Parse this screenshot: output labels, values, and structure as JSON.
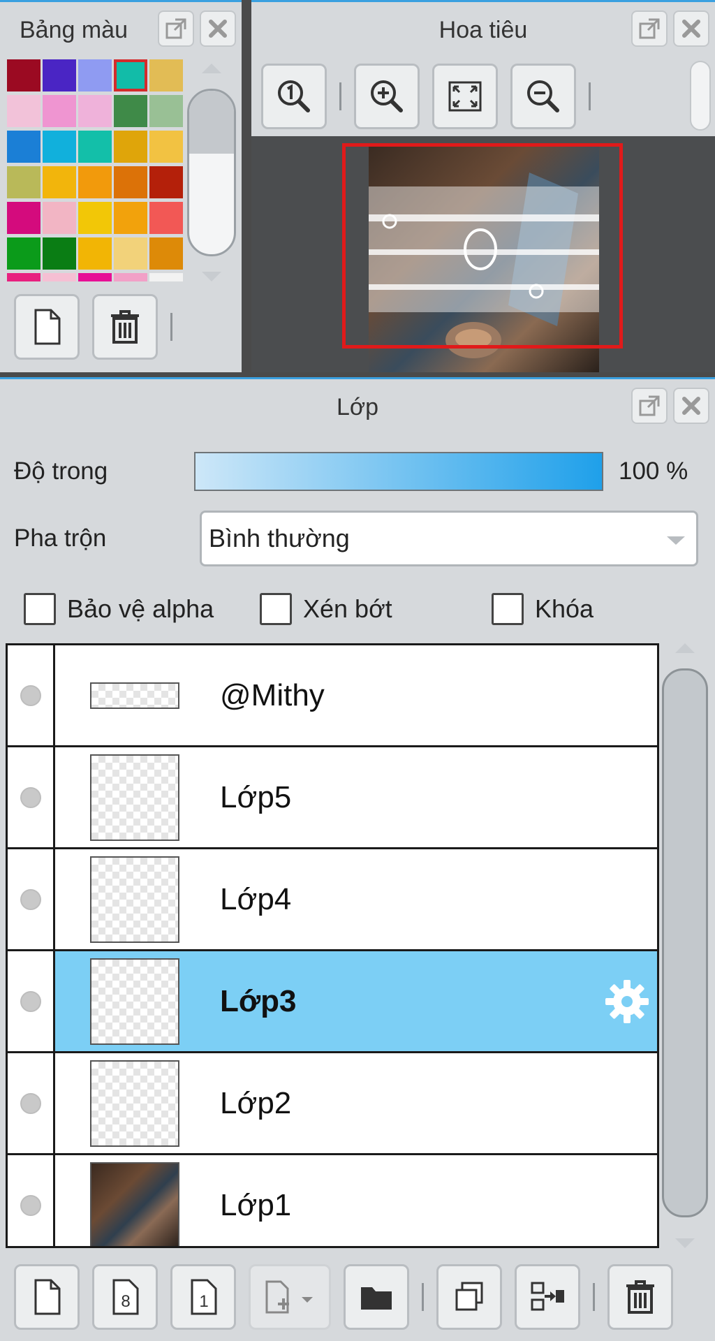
{
  "palette": {
    "title": "Bảng màu",
    "swatches": [
      {
        "color": "#9b0a22"
      },
      {
        "color": "#4a25c4"
      },
      {
        "color": "#8f9bf2"
      },
      {
        "color": "#12bca8",
        "selected": true
      },
      {
        "color": "#e2bc55"
      },
      {
        "color": "#f2c2d9"
      },
      {
        "color": "#ef95d1"
      },
      {
        "color": "#efb2da"
      },
      {
        "color": "#3f8a48"
      },
      {
        "color": "#99c095"
      },
      {
        "color": "#1b7fd6"
      },
      {
        "color": "#11b0dc"
      },
      {
        "color": "#13bfa9"
      },
      {
        "color": "#dfa50a"
      },
      {
        "color": "#f2c242"
      },
      {
        "color": "#b9b959"
      },
      {
        "color": "#f2b50c"
      },
      {
        "color": "#f29a0c"
      },
      {
        "color": "#dc7208"
      },
      {
        "color": "#b4200a"
      },
      {
        "color": "#d40b7d"
      },
      {
        "color": "#f2b5c4"
      },
      {
        "color": "#f2c707"
      },
      {
        "color": "#f2a20c"
      },
      {
        "color": "#f25855"
      },
      {
        "color": "#0b9b1a"
      },
      {
        "color": "#0a7d14"
      },
      {
        "color": "#f2b505"
      },
      {
        "color": "#f2d27a"
      },
      {
        "color": "#dd8a08"
      },
      {
        "color": "#e8207f"
      },
      {
        "color": "#f5bfd3"
      },
      {
        "color": "#e70f95"
      },
      {
        "color": "#f2a0c7"
      },
      {
        "color": "#f2f2f2"
      }
    ],
    "buttons": [
      "new-swatch",
      "delete-swatch"
    ]
  },
  "navigator": {
    "title": "Hoa tiêu",
    "tools": [
      "zoom-actual",
      "zoom-in",
      "fit-screen",
      "zoom-out"
    ]
  },
  "layers": {
    "title": "Lớp",
    "opacity_label": "Độ trong",
    "opacity_value": "100 %",
    "opacity_fraction": 1.0,
    "blend_label": "Pha trộn",
    "blend_value": "Bình thường",
    "checkboxes": {
      "alpha": "Bảo vệ alpha",
      "clip": "Xén bớt",
      "lock": "Khóa"
    },
    "items": [
      {
        "name": "@Mithy",
        "thumb": "wide",
        "active": false
      },
      {
        "name": "Lớp5",
        "thumb": "empty",
        "active": false
      },
      {
        "name": "Lớp4",
        "thumb": "empty",
        "active": false
      },
      {
        "name": "Lớp3",
        "thumb": "empty",
        "active": true
      },
      {
        "name": "Lớp2",
        "thumb": "empty",
        "active": false
      },
      {
        "name": "Lớp1",
        "thumb": "photo",
        "active": false
      }
    ]
  },
  "colors": {
    "panel_bg": "#d6d9dc",
    "accent": "#3aa0e0",
    "active_layer": "#7ccff5",
    "nav_frame": "#e01a1a"
  }
}
